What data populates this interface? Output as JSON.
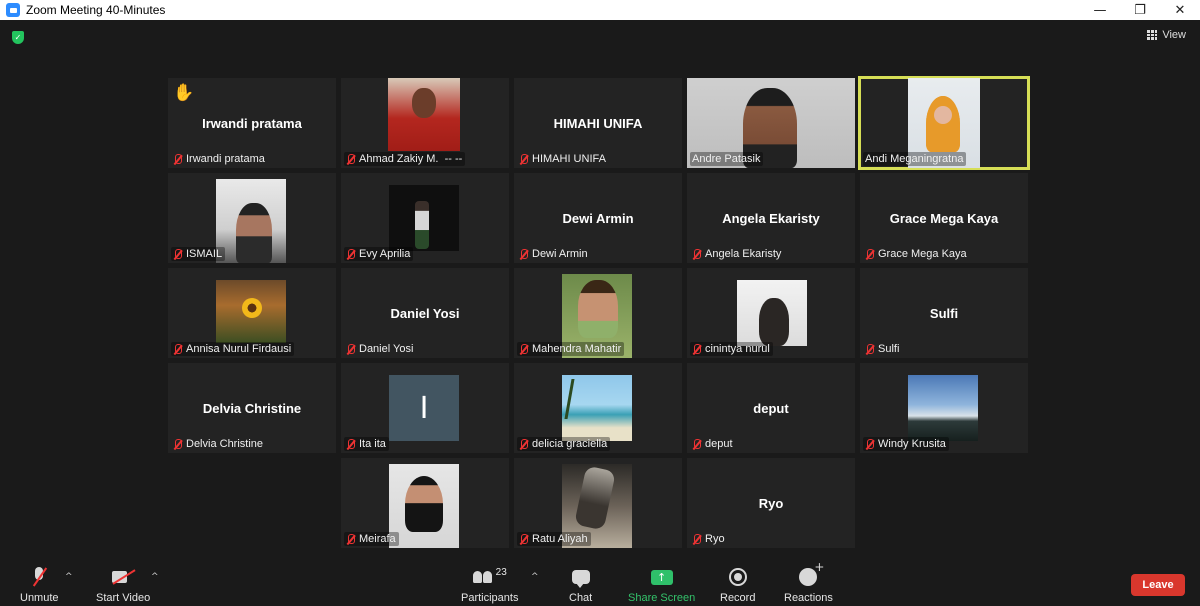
{
  "window": {
    "title": "Zoom Meeting 40-Minutes",
    "controls": {
      "minimize": "—",
      "maximize": "❐",
      "close": "✕"
    }
  },
  "topbar": {
    "security_icon": "shield-check-icon",
    "view_label": "View"
  },
  "gallery": [
    {
      "name": "Irwandi pratama",
      "display": "Irwandi pratama",
      "muted": true,
      "hand_raised": true
    },
    {
      "name": "Ahmad Zakiy M.  -- --",
      "display": "",
      "muted": true,
      "photo": "red-shirt"
    },
    {
      "name": "HIMAHI UNIFA",
      "display": "HIMAHI UNIFA",
      "muted": true
    },
    {
      "name": "Andre Patasik",
      "display": "",
      "muted": false,
      "photo": "live-video"
    },
    {
      "name": "Andi Meganingratna",
      "display": "",
      "muted": false,
      "photo": "live-video",
      "active_speaker": true
    },
    {
      "name": "ISMAIL",
      "display": "",
      "muted": true,
      "photo": "portrait"
    },
    {
      "name": "Evy Aprilia",
      "display": "",
      "muted": true,
      "photo": "dark-portrait"
    },
    {
      "name": "Dewi Armin",
      "display": "Dewi Armin",
      "muted": true
    },
    {
      "name": "Angela Ekaristy",
      "display": "Angela Ekaristy",
      "muted": true
    },
    {
      "name": "Grace Mega Kaya",
      "display": "Grace Mega Kaya",
      "muted": true
    },
    {
      "name": "Annisa Nurul Firdausi",
      "display": "",
      "muted": true,
      "photo": "sunflower"
    },
    {
      "name": "Daniel Yosi",
      "display": "Daniel Yosi",
      "muted": true
    },
    {
      "name": "Mahendra Mahatir",
      "display": "",
      "muted": true,
      "photo": "portrait"
    },
    {
      "name": "cinintya nurul",
      "display": "",
      "muted": true,
      "photo": "cat"
    },
    {
      "name": "Sulfi",
      "display": "Sulfi",
      "muted": true
    },
    {
      "name": "Delvia Christine",
      "display": "Delvia Christine",
      "muted": true
    },
    {
      "name": "Ita ita",
      "display": "",
      "muted": true,
      "photo": "letter",
      "letter": "I"
    },
    {
      "name": "delicia graciella",
      "display": "",
      "muted": true,
      "photo": "beach"
    },
    {
      "name": "deput",
      "display": "deput",
      "muted": true
    },
    {
      "name": "Windy Krusita",
      "display": "",
      "muted": true,
      "photo": "sunset"
    },
    {
      "name": "Meirafa",
      "display": "",
      "muted": true,
      "photo": "portrait"
    },
    {
      "name": "Ratu Aliyah",
      "display": "",
      "muted": true,
      "photo": "portrait"
    },
    {
      "name": "Ryo",
      "display": "Ryo",
      "muted": true
    }
  ],
  "toolbar": {
    "unmute_label": "Unmute",
    "start_video_label": "Start Video",
    "participants_label": "Participants",
    "participants_count": "23",
    "chat_label": "Chat",
    "share_screen_label": "Share Screen",
    "record_label": "Record",
    "reactions_label": "Reactions",
    "leave_label": "Leave",
    "caret": "^"
  },
  "colors": {
    "background": "#1a1a1a",
    "tile": "#232323",
    "active_speaker_border": "#d6de56",
    "muted_icon": "#e33333",
    "share_screen": "#2fc06a",
    "leave_button": "#d9372d"
  }
}
